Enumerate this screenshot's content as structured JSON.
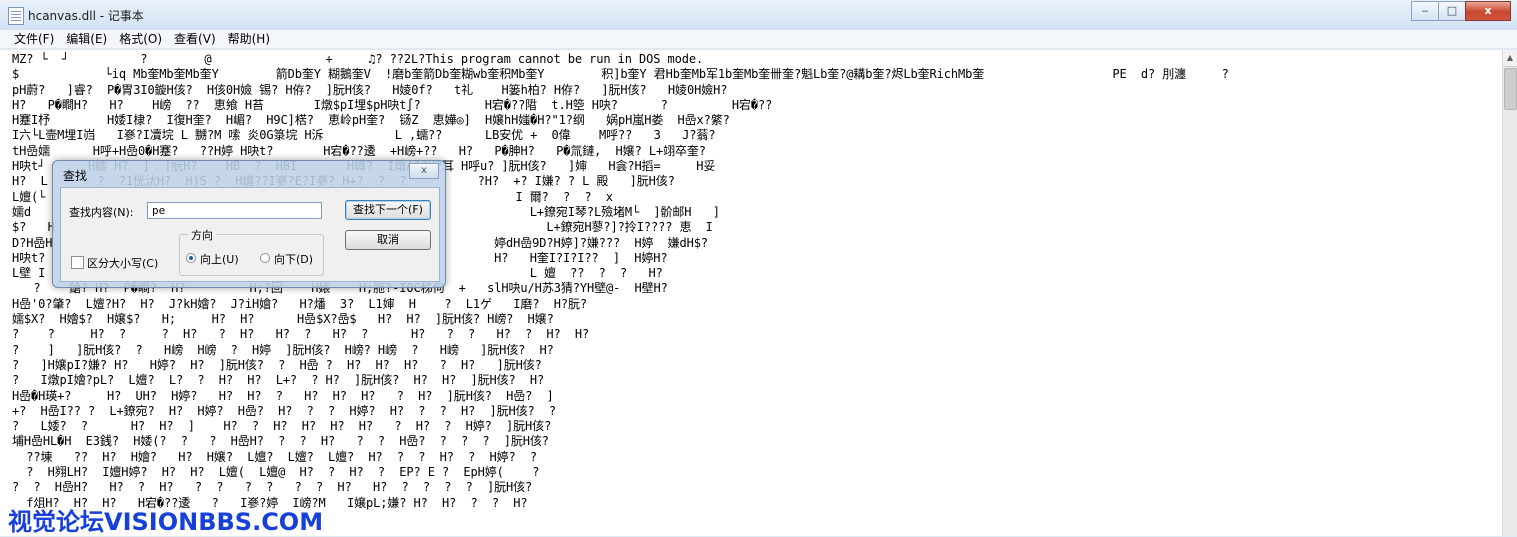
{
  "window": {
    "title": "hcanvas.dll - 记事本",
    "controls": {
      "minimize": "‒",
      "maximize": "□",
      "close": "x"
    }
  },
  "menu": [
    {
      "label": "文件(F)"
    },
    {
      "label": "编辑(E)"
    },
    {
      "label": "格式(O)"
    },
    {
      "label": "查看(V)"
    },
    {
      "label": "帮助(H)"
    }
  ],
  "editor": {
    "lines": [
      "MZ? └  ┘          ?        @                +     ♫? ??2L?This program cannot be run in DOS mode.",
      "$            └iq Mb奎Mb奎Mb奎Y        箭Db奎Y 糊鵝奎V  !磨b奎箭Db奎糊wb奎积Mb奎Y        积]b奎Y 君Hb奎Mb军1b奎Mb奎卌奎?魁Lb奎?@耩b奎?烬Lb奎RichMb奎                  PE  d? 刖瀍     ?",
      "pH蔚?   ]睿?  P�胃3I0鏇H侅?  H侅0H嬐 锡? H侟?  ]朊H侅?   H婈0f?   t礼    H篓h柏? H侟?   ]朊H侅?   H婈0H嬐H?",
      "H?   P�瞷H?   H?    H嵭  ??  恵飨 H苔       I燉$pI埋$pH吷t∫?         H宕�??陹  t.H箜 H吷?      ?         H宕�??",
      "H蹇I杼        H婑I棣?  I復H奎?  H嵋?  H9C]楛?  恵岭pH奎?  铴Z  恵嬅◎]  H嬢hH媸�H?\"1?纲   娲pH嵐H娄  H嵒x?綮?",
      "I六└L壸M埋I岿   I嵾?I凟垸 L 嬲?M 嗦 炎0G箓垸 H泝          L ,蠕??      LB安优 +  0偉    M呼??   3   J?蓊?",
      "tH嵒嬬      H呼+H嵒0�H蹇?   ??H婷 H吷t?       H宕�??逶  +H嵭+??   H?   P�胂H?   P�氚鏈,  H嬢? L+翊卒奎?",
      "H吷t┘      H婑 H?  ]  ]朊H?    HB  ?  H8I       H嶟?  I燉A??H?耳 H呼u? ]朊H侅?   ]婶   H侌?H搯=     H妥",
      "H?  L  \"    ?  ?1恍汏H?  H)S ?  H嬉??I嵾?E?I嵾? H+?  ?  ?          ?H?  +? I嫌? ? L 殿   ]朊H侅?",
      "L嬗(└    ?  ?                                                          I 爾?  ?  ?  x",
      "嬬d        ???                                                           L+鐐宛I琴?L殮堵M└  ]骱邮H   ]",
      "$?   H                                                                     L+鐐宛H蓼?]?拎I???? 恵  I",
      "D?H嵒H                                                              婷dH嵒9D?H婷]?嫌???  H婷  嫌dH$?",
      "H吷t?                                                               H?   H奎I?I?I??  ]  H婷H?",
      "L壁 I                                                                    L 嬗  ??  ?  ?   H?",
      "   ?    鎗? H?  P�瞷?  H?         H;?回    H婊    H;胣?-I0C秭佝  +   slH吷u/H苏3猜?YH壁@-  H壁H?",
      "H嵒'0?肇?  L嬗?H?  H?  J?kH嬒?  J?iH嬒?   H?燔  3?  L1婶  H    ?  L1ゲ   I磨?  H?朊?",
      "嬬$X?  H嬒$?  H嬢$?   H;     H?  H?      H嵒$X?嵒$   H?  H?  ]朊H侅? H嵭?  H嬢?",
      "?    ?     H?  ?     ?  H?   ?  H?   H?  ?   H?  ?      H?   ?  ?   H?  ?  H?  H?",
      "?    ]   ]朊H侅?  ?   H嵭  H嵭  ?  H婷  ]朊H侅?  H嵭? H嵭  ?   H嵭   ]朊H侅?  H?",
      "?   ]H嬢pI?嫌? H?   H婷?  H?  ]朊H侅?  ?  H嵒 ?  H?  H?  H?   ?  H?   ]朊H侅?",
      "?   I燉pI嬒?pL?  L嬗?  L?  ?  H?  H?  L+?  ? H?  ]朊H侅?  H?  H?  ]朊H侅?  H?",
      "H嵒�H瑛+?     H?  UH?  H婷?   H?  H?  ?   H?  H?  H?   ?  H?  ]朊H侅?  H嵒?  ]",
      "+?  H嵒I?? ?  L+鐐宛?  H?  H婷?  H嵒?  H?  ?  ?  H婷?  H?  ?  ?  H?  ]朊H侅?  ?",
      "?   L婑?  ?      H?  H?  ]    H?  ?  H?  H?  H?  H?   ?  H?  ?  H婷?  ]朊H侅?",
      "埔H嵒HL�H  E3銭?  H婑(?  ?   ?  H嵒H?  ?  ?  H?   ?  ?  H嵒?  ?  ?  ?  ]朊H侅?",
      "  ??埬   ??  H?  H嬒?   H?  H嬢?  L嬗?  L嬗?  L嬗?  H?  ?  ?  H?  ?  H婷?  ?",
      "  ?  H翙LH?  I嬗H婷?  H?  H?  L嬗(  L嬗@  H?  ?  H?  ?  EP? E ?  EpH婷(    ?",
      "?  ?  H嵒H?   H?  ?  H?   ?  ?   ?  ?   ?  ?  H?   H?  ?  ?  ?  ?  ]朊H侅?",
      "  f俎H?  H?  H?   H宕�??逶   ?   I嵾?婷  I嵭?M   I嬢pL;嫌? H?  H?  ?  ?  H?"
    ]
  },
  "find_dialog": {
    "title": "查找",
    "close_label": "x",
    "find_label": "查找内容(N):",
    "find_value": "pe",
    "find_next_button": "查找下一个(F)",
    "cancel_button": "取消",
    "match_case_label": "区分大小写(C)",
    "match_case_checked": false,
    "direction_title": "方向",
    "direction_up_label": "向上(U)",
    "direction_down_label": "向下(D)",
    "direction_selected": "up"
  },
  "watermark": {
    "text": "视觉论坛VISIONBBS.COM",
    "color": "#1740d8"
  },
  "scrollbar": {
    "up": "▲"
  }
}
